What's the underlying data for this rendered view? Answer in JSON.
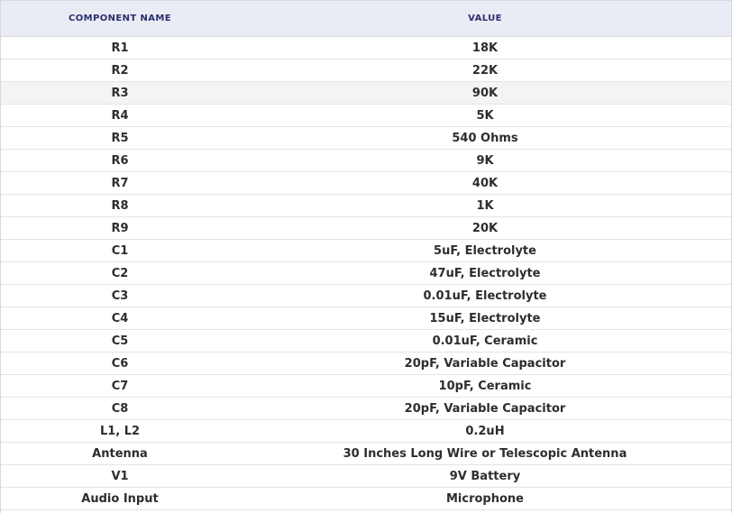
{
  "table": {
    "headers": [
      "COMPONENT NAME",
      "VALUE"
    ],
    "rows": [
      [
        "R1",
        "18K"
      ],
      [
        "R2",
        "22K"
      ],
      [
        "R3",
        "90K"
      ],
      [
        "R4",
        "5K"
      ],
      [
        "R5",
        "540 Ohms"
      ],
      [
        "R6",
        "9K"
      ],
      [
        "R7",
        "40K"
      ],
      [
        "R8",
        "1K"
      ],
      [
        "R9",
        "20K"
      ],
      [
        "C1",
        "5uF, Electrolyte"
      ],
      [
        "C2",
        "47uF, Electrolyte"
      ],
      [
        "C3",
        "0.01uF, Electrolyte"
      ],
      [
        "C4",
        "15uF, Electrolyte"
      ],
      [
        "C5",
        "0.01uF, Ceramic"
      ],
      [
        "C6",
        "20pF, Variable Capacitor"
      ],
      [
        "C7",
        "10pF, Ceramic"
      ],
      [
        "C8",
        "20pF, Variable Capacitor"
      ],
      [
        "L1, L2",
        "0.2uH"
      ],
      [
        "Antenna",
        "30 Inches Long Wire or Telescopic Antenna"
      ],
      [
        "V1",
        "9V Battery"
      ],
      [
        "Audio Input",
        "Microphone"
      ]
    ]
  },
  "colors": {
    "header_bg": "#e9ecf5",
    "header_text": "#2b2f6b",
    "highlight_row_bg": "#f4f4f4",
    "text": "#2d2d2d"
  }
}
